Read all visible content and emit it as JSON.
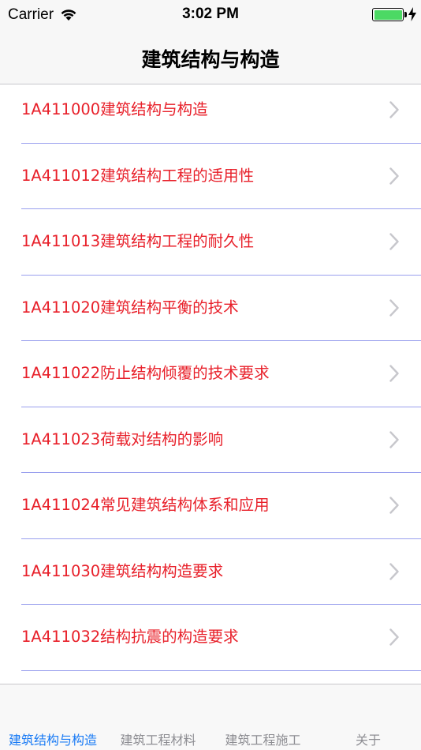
{
  "status_bar": {
    "carrier": "Carrier",
    "time": "3:02 PM",
    "battery_color": "#4cd964"
  },
  "nav": {
    "title": "建筑结构与构造"
  },
  "list": {
    "label_color": "#e8202a",
    "items": [
      {
        "label": "1A411000建筑结构与构造"
      },
      {
        "label": "1A411012建筑结构工程的适用性"
      },
      {
        "label": "1A411013建筑结构工程的耐久性"
      },
      {
        "label": "1A411020建筑结构平衡的技术"
      },
      {
        "label": "1A411022防止结构倾覆的技术要求"
      },
      {
        "label": "1A411023荷载对结构的影响"
      },
      {
        "label": "1A411024常见建筑结构体系和应用"
      },
      {
        "label": "1A411030建筑结构构造要求"
      },
      {
        "label": "1A411032结构抗震的构造要求"
      }
    ]
  },
  "tab_bar": {
    "active_color": "#1a7bf5",
    "tabs": [
      {
        "label": "建筑结构与构造",
        "active": true
      },
      {
        "label": "建筑工程材料",
        "active": false
      },
      {
        "label": "建筑工程施工",
        "active": false
      },
      {
        "label": "关于",
        "active": false
      }
    ]
  }
}
